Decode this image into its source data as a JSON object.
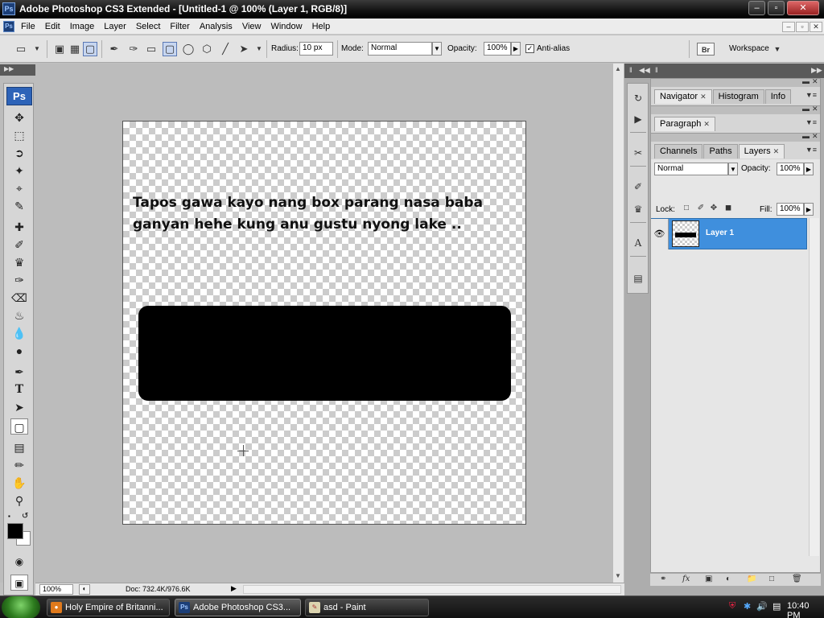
{
  "window": {
    "title": "Adobe Photoshop CS3 Extended - [Untitled-1 @ 100% (Layer 1, RGB/8)]",
    "app_icon": "Ps"
  },
  "menu": [
    "File",
    "Edit",
    "Image",
    "Layer",
    "Select",
    "Filter",
    "Analysis",
    "View",
    "Window",
    "Help"
  ],
  "options": {
    "radius_label": "Radius:",
    "radius_value": "10 px",
    "mode_label": "Mode:",
    "mode_value": "Normal",
    "opacity_label": "Opacity:",
    "opacity_value": "100%",
    "antialias_label": "Anti-alias",
    "antialias_checked": true,
    "bridge_label": "Br",
    "workspace_label": "Workspace"
  },
  "toolbox": {
    "badge": "Ps"
  },
  "canvas": {
    "text_line1": "Tapos gawa kayo nang box parang nasa baba",
    "text_line2": "ganyan hehe kung anu gustu nyong lake ..",
    "box_color": "#000000"
  },
  "status": {
    "zoom": "100%",
    "doc": "Doc: 732.4K/976.6K"
  },
  "panels": {
    "top_tabs": [
      {
        "label": "Navigator",
        "active": true
      },
      {
        "label": "Histogram",
        "active": false
      },
      {
        "label": "Info",
        "active": false
      }
    ],
    "para_tabs": [
      {
        "label": "Paragraph",
        "active": true
      }
    ],
    "layer_tabs": [
      {
        "label": "Channels",
        "active": false
      },
      {
        "label": "Paths",
        "active": false
      },
      {
        "label": "Layers",
        "active": true
      }
    ]
  },
  "layers": {
    "blend_mode": "Normal",
    "opacity_label": "Opacity:",
    "opacity_value": "100%",
    "lock_label": "Lock:",
    "fill_label": "Fill:",
    "fill_value": "100%",
    "layer_name": "Layer 1"
  },
  "taskbar": {
    "items": [
      {
        "label": "Holy Empire of Britanni...",
        "icon": "firefox-icon"
      },
      {
        "label": "Adobe Photoshop CS3...",
        "icon": "photoshop-icon"
      },
      {
        "label": "asd - Paint",
        "icon": "paint-icon"
      }
    ],
    "clock": "10:40 PM"
  },
  "colors": {
    "selection_blue": "#3f8fdd",
    "foreground": "#000000",
    "background": "#ffffff"
  }
}
